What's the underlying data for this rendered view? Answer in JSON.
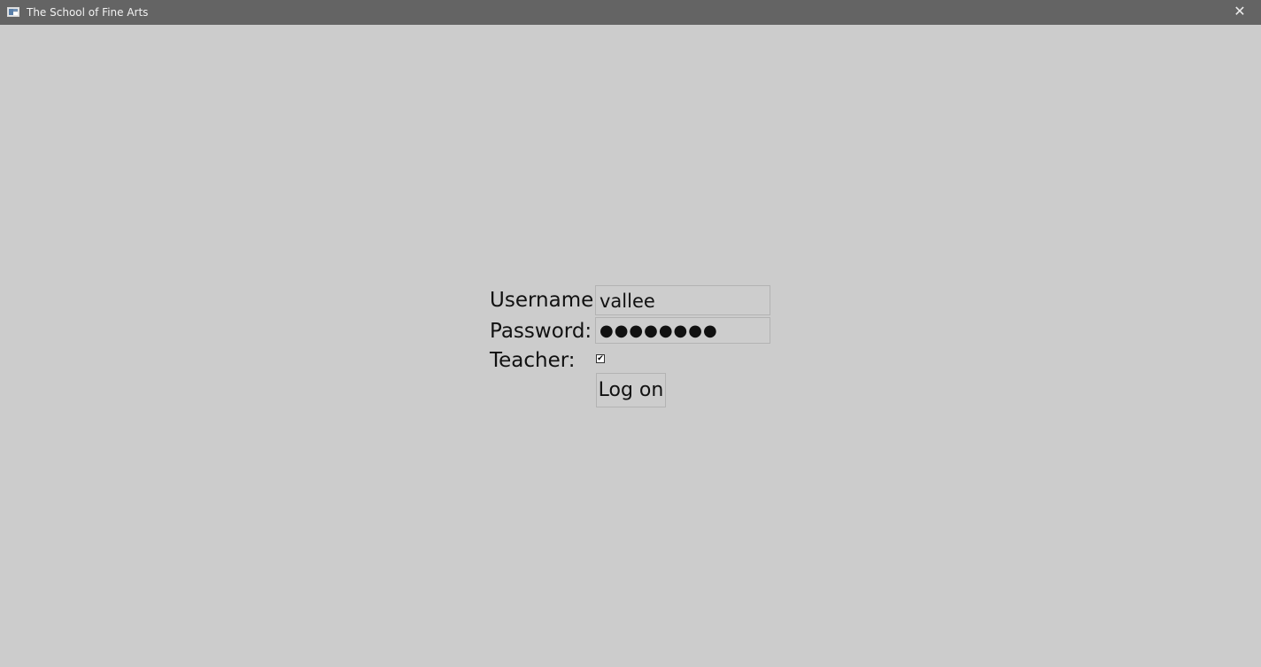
{
  "window": {
    "title": "The School of Fine Arts",
    "close_glyph": "✕"
  },
  "login": {
    "username_label": "Username:",
    "username_value": "vallee",
    "password_label": "Password:",
    "password_value": "●●●●●●●●",
    "teacher_label": "Teacher:",
    "teacher_checked": true,
    "checkbox_glyph": "✔",
    "logon_label": "Log on"
  },
  "icons": {
    "app": "app-window-icon",
    "close": "close-icon",
    "check": "checkmark-icon"
  }
}
